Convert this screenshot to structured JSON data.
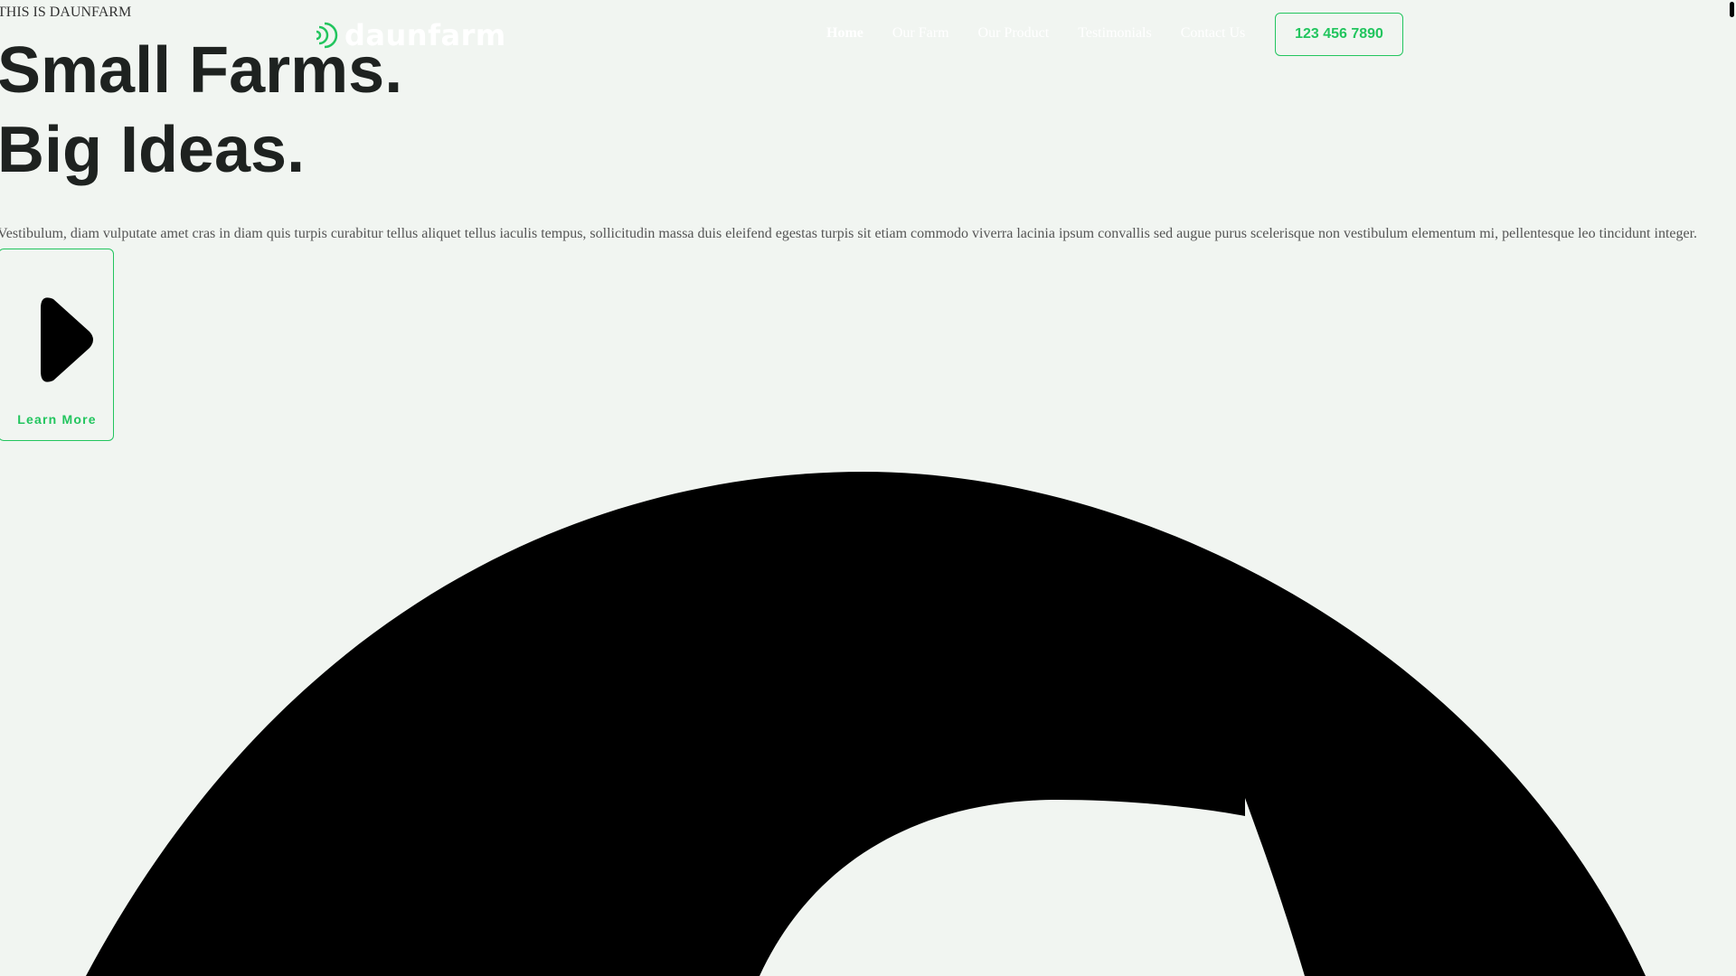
{
  "brand": {
    "logo_text": "daunfarm",
    "accent_color": "#22c55e"
  },
  "nav": {
    "items": [
      {
        "label": "Home",
        "active": true
      },
      {
        "label": "Our Farm",
        "active": false
      },
      {
        "label": "Our Product",
        "active": false
      },
      {
        "label": "Testimonials",
        "active": false
      },
      {
        "label": "Contact Us",
        "active": false
      }
    ],
    "phone": "123 456 7890"
  },
  "hero": {
    "eyebrow": "THIS IS DAUNFARM",
    "headline_line1": "Small Farms.",
    "headline_line2": "Big Ideas.",
    "lead": "Vestibulum, diam vulputate amet cras in diam quis turpis curabitur tellus aliquet tellus iaculis tempus, sollicitudin massa duis eleifend egestas turpis sit etiam commodo viverra lacinia ipsum convallis sed augue purus scelerisque non vestibulum elementum mi, pellentesque leo tincidunt integer.",
    "cta_label": "Learn More",
    "cta_icon": "chevron-right-icon"
  }
}
